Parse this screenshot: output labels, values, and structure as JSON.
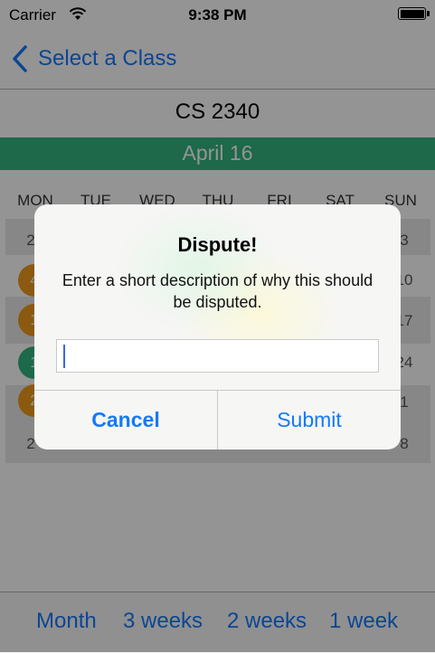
{
  "status_bar": {
    "carrier": "Carrier",
    "time": "9:38 PM"
  },
  "nav": {
    "back_label": "Select a Class"
  },
  "class_title": "CS 2340",
  "date_banner": "April 16",
  "weekdays": [
    "MON",
    "TUE",
    "WED",
    "THU",
    "FRI",
    "SAT",
    "SUN"
  ],
  "calendar": {
    "row1": {
      "mon": "2",
      "sun": "3"
    },
    "row2": {
      "mon_badge": "4",
      "sun": "10"
    },
    "row3": {
      "mon_badge": "1",
      "sun": "17"
    },
    "row4": {
      "mon_badge": "1",
      "sun": "24"
    },
    "row5": {
      "mon_badge": "2",
      "sun": "1"
    },
    "row6": {
      "mon": "2",
      "sun": "8"
    }
  },
  "colors": {
    "accent": "#1479fb",
    "green": "#33b580",
    "orange": "#f09a1a"
  },
  "alert": {
    "title": "Dispute!",
    "message": "Enter a short description of why this should be disputed.",
    "input_value": "",
    "cancel_label": "Cancel",
    "submit_label": "Submit"
  },
  "bottom_tabs": [
    "Month",
    "3 weeks",
    "2 weeks",
    "1 week"
  ]
}
